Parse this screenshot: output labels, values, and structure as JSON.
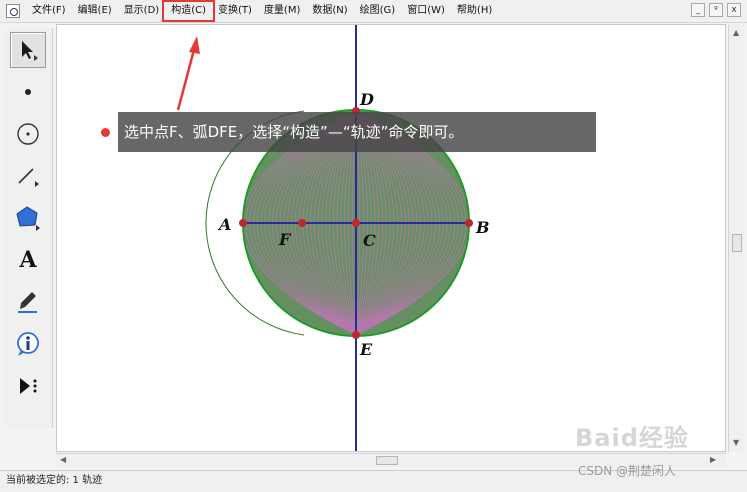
{
  "menubar": {
    "items": [
      "文件(F)",
      "编辑(E)",
      "显示(D)",
      "构造(C)",
      "变换(T)",
      "度量(M)",
      "数据(N)",
      "绘图(G)",
      "窗口(W)",
      "帮助(H)"
    ],
    "highlighted_index": 3,
    "window_buttons": [
      "_",
      "ᵍ",
      "x"
    ]
  },
  "toolbox": {
    "tools": [
      {
        "name": "selection-arrow-tool",
        "icon": "arrow-icon",
        "active": true
      },
      {
        "name": "point-tool",
        "icon": "point-icon",
        "active": false
      },
      {
        "name": "compass-tool",
        "icon": "circle-icon",
        "active": false
      },
      {
        "name": "straightedge-tool",
        "icon": "segment-icon",
        "active": false
      },
      {
        "name": "polygon-tool",
        "icon": "polygon-icon",
        "active": false
      },
      {
        "name": "text-tool",
        "icon": "text-icon",
        "label": "A",
        "active": false
      },
      {
        "name": "marker-tool",
        "icon": "pen-icon",
        "active": false
      },
      {
        "name": "information-tool",
        "icon": "info-icon",
        "active": false
      },
      {
        "name": "custom-tool",
        "icon": "custom-tool-icon",
        "active": false
      }
    ]
  },
  "callout": {
    "text": "选中点F、弧DFE，选择“构造”—“轨迹”命令即可。"
  },
  "canvas": {
    "points": [
      {
        "label": "D"
      },
      {
        "label": "A"
      },
      {
        "label": "F"
      },
      {
        "label": "C"
      },
      {
        "label": "B"
      },
      {
        "label": "E"
      }
    ],
    "colors": {
      "circle_fill": "#5f8a5a",
      "circle_stroke": "#1f9a2a",
      "locus_lines": "#d070c8",
      "axis": "#2a2a9a",
      "point": "#c0272d"
    }
  },
  "statusbar": {
    "text": "当前被选定的: 1 轨迹"
  },
  "watermarks": {
    "baidu": "Baid经验",
    "csdn": "CSDN @荆楚闲人"
  }
}
